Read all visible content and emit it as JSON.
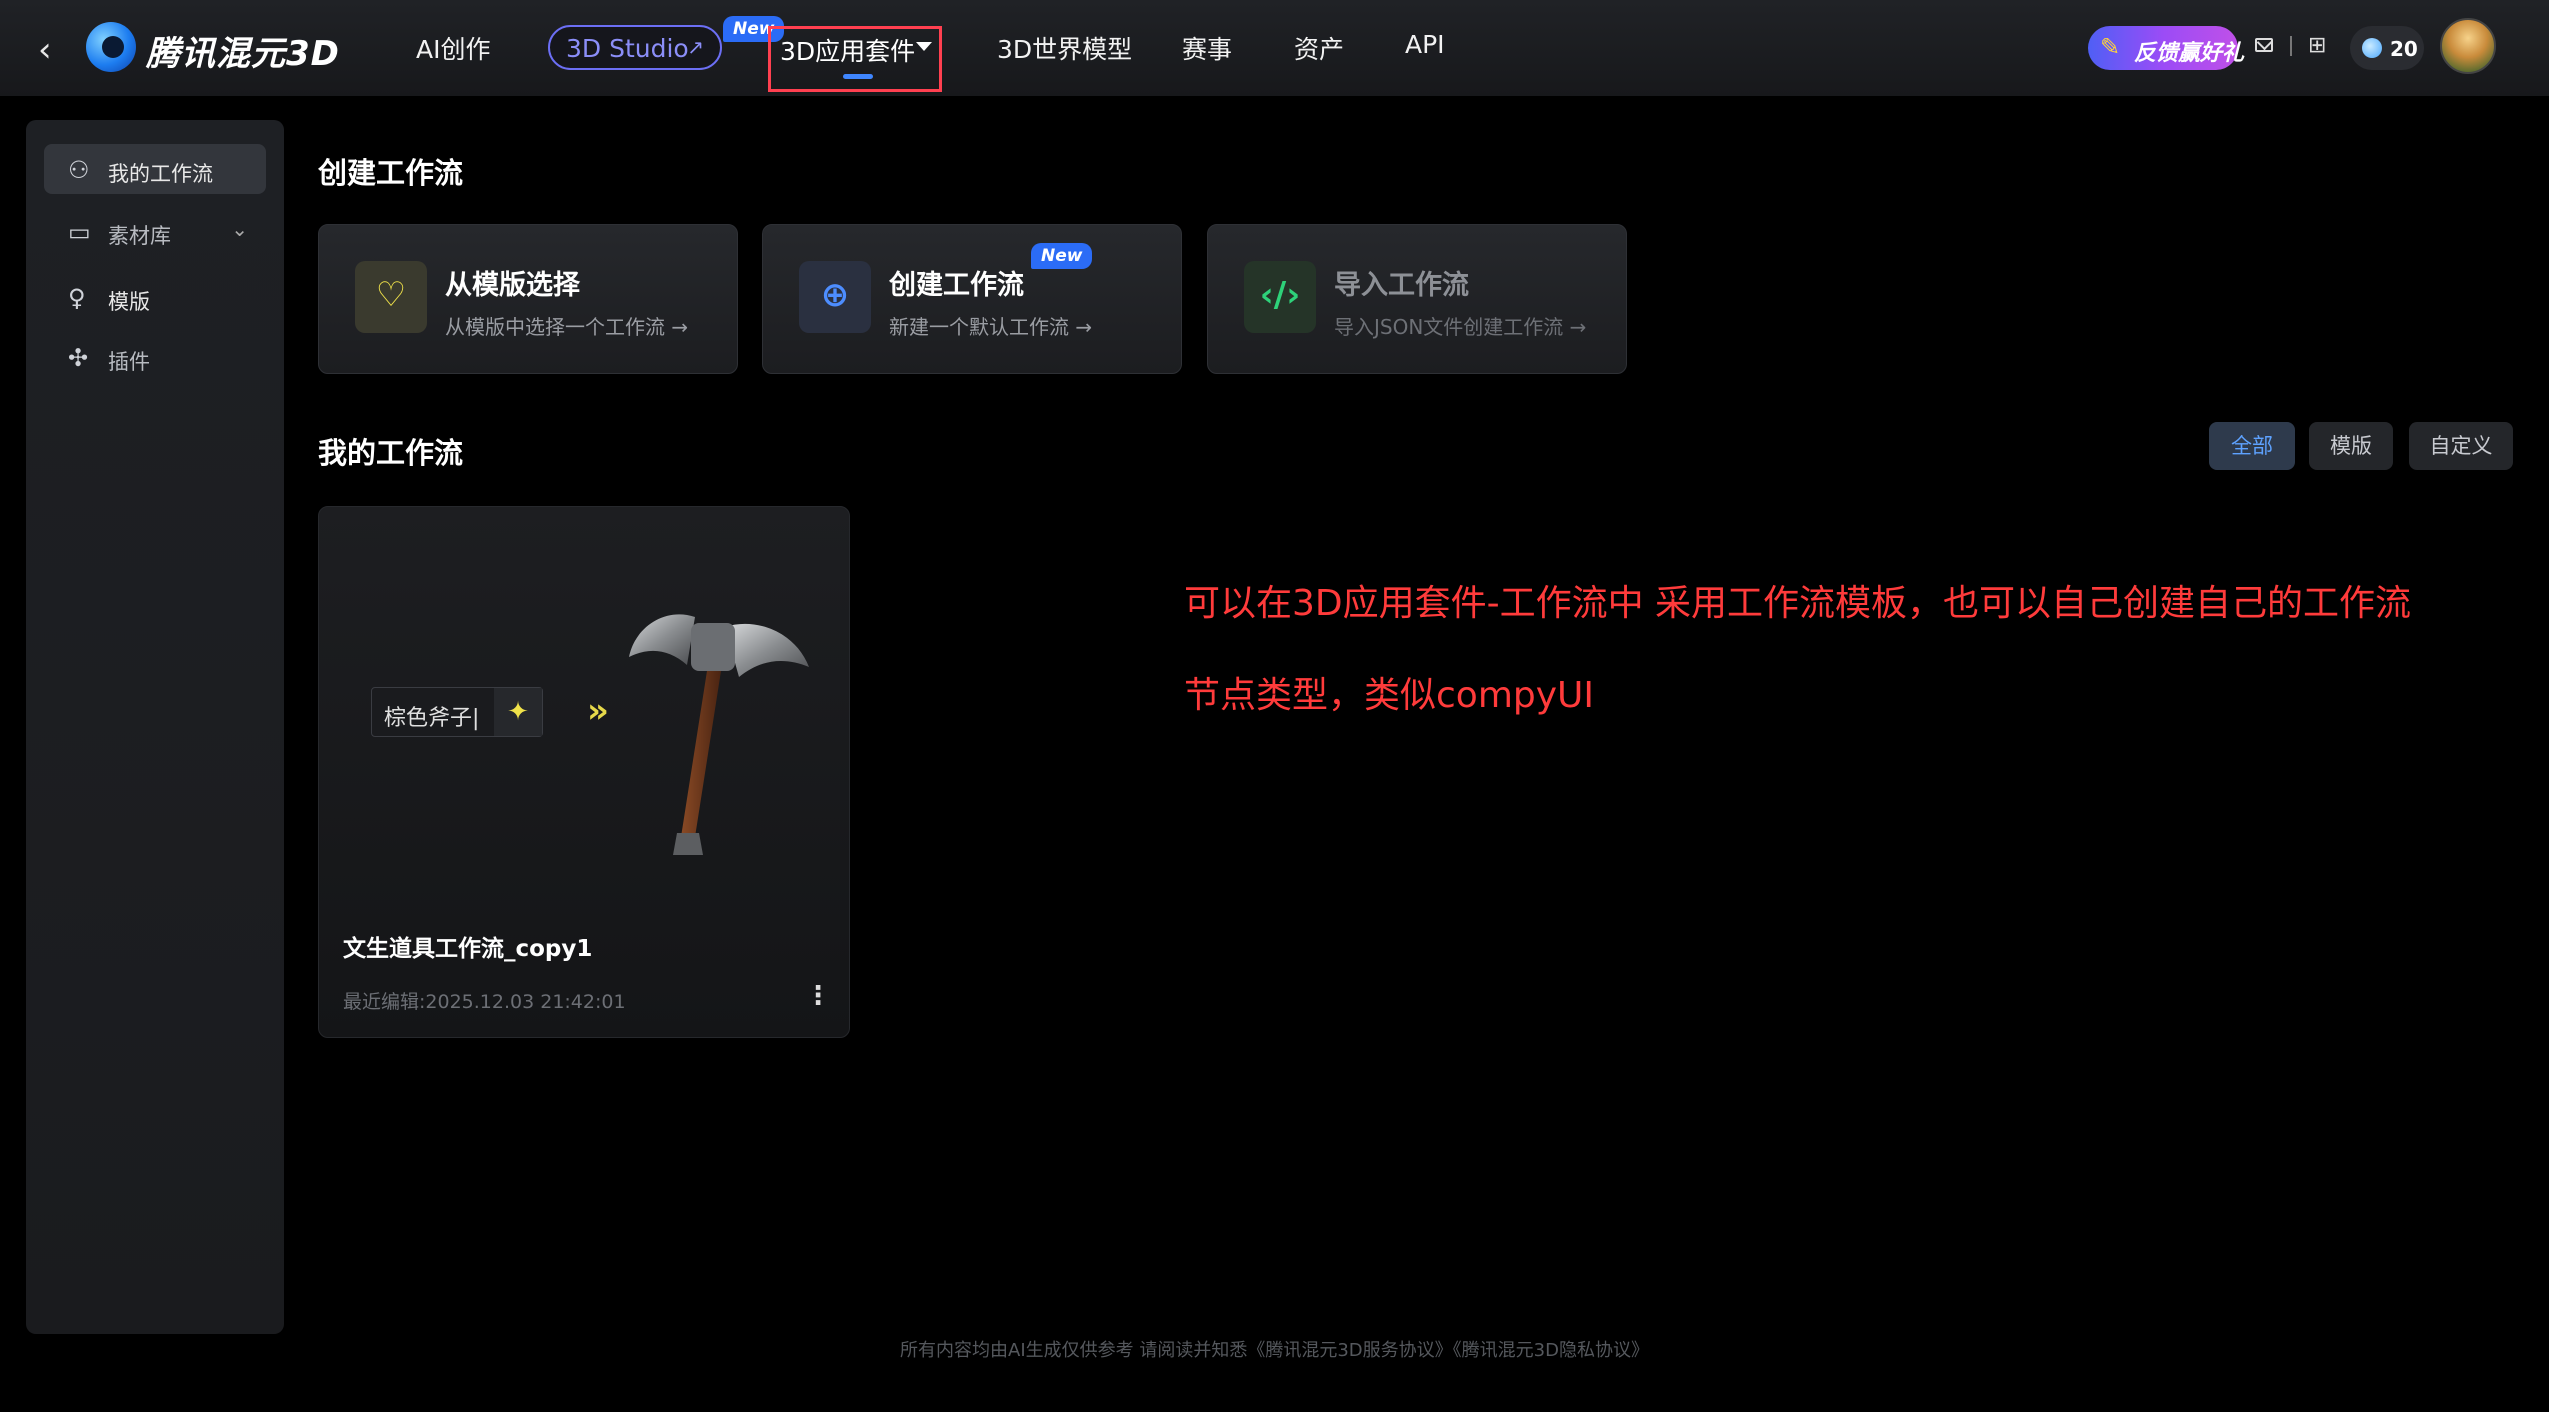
{
  "topbar": {
    "brand": "腾讯混元3D",
    "nav": {
      "ai_create": "AI创作",
      "studio": "3D Studio",
      "studio_badge": "New",
      "suite": "3D应用套件",
      "world": "3D世界模型",
      "event": "赛事",
      "asset": "资产",
      "api": "API"
    },
    "feedback_label": "反馈赢好礼",
    "credits": "20"
  },
  "sidebar": {
    "items": [
      {
        "label": "我的工作流",
        "icon": "workflow-icon",
        "active": true
      },
      {
        "label": "素材库",
        "icon": "folder-icon",
        "expandable": true
      },
      {
        "label": "模版",
        "icon": "lightbulb-icon"
      },
      {
        "label": "插件",
        "icon": "plugin-icon"
      }
    ]
  },
  "create_section": {
    "title": "创建工作流",
    "cards": [
      {
        "title": "从模版选择",
        "subtitle": "从模版中选择一个工作流 →",
        "icon": "lightbulb-icon"
      },
      {
        "title": "创建工作流",
        "subtitle": "新建一个默认工作流 →",
        "icon": "plus-circle-icon",
        "badge": "New"
      },
      {
        "title": "导入工作流",
        "subtitle": "导入JSON文件创建工作流 →",
        "icon": "code-icon",
        "disabled": true
      }
    ]
  },
  "my_section": {
    "title": "我的工作流",
    "filters": [
      "全部",
      "模版",
      "自定义"
    ],
    "selected_filter": "全部",
    "workflows": [
      {
        "prompt_chip": "棕色斧子|",
        "title": "文生道具工作流_copy1",
        "edited": "最近编辑:2025.12.03 21:42:01"
      }
    ]
  },
  "annotation": {
    "line1": "可以在3D应用套件-工作流中 采用工作流模板，也可以自己创建自己的工作流",
    "line2": "节点类型，类似compyUI",
    "color": "#ff3b3b"
  },
  "footer": "所有内容均由AI生成仅供参考 请阅读并知悉《腾讯混元3D服务协议》《腾讯混元3D隐私协议》",
  "colors": {
    "accent": "#2b6cf6",
    "highlight_box": "#ff4050",
    "studio": "#8b8ef8"
  }
}
